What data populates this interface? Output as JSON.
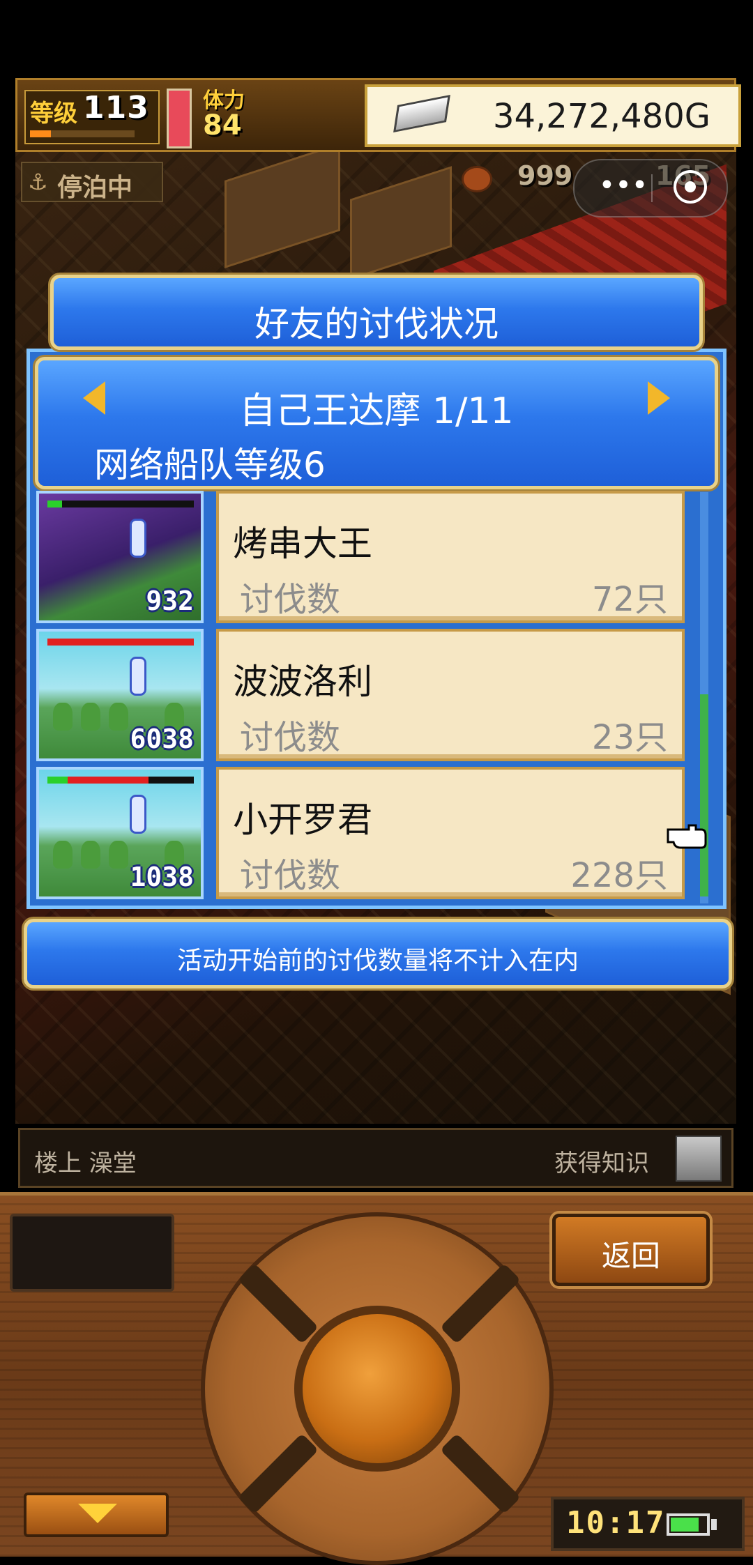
{
  "hud": {
    "level_label": "等级",
    "level": "113",
    "level_progress": 0.2,
    "stamina_label": "体力",
    "stamina": "84",
    "gold": "34,272,480G",
    "moor_label": "停泊中",
    "resource1": "999",
    "resource2": "165"
  },
  "capsule": {
    "more": "•••"
  },
  "dialog": {
    "title": "好友的讨伐状况",
    "monster": "自己王达摩 1/11",
    "fleet_level": "网络船队等级6",
    "notice": "活动开始前的讨伐数量将不计入在内"
  },
  "friends": [
    {
      "name": "烤串大王",
      "kill_label": "讨伐数",
      "kills": "72只",
      "score": "932",
      "hp_fraction": 0.0,
      "green_fraction": 0.1
    },
    {
      "name": "波波洛利",
      "kill_label": "讨伐数",
      "kills": "23只",
      "score": "6038",
      "hp_fraction": 1.0,
      "green_fraction": 0.0
    },
    {
      "name": "小开罗君",
      "kill_label": "讨伐数",
      "kills": "228只",
      "score": "1038",
      "hp_fraction": 0.55,
      "green_fraction": 0.14
    }
  ],
  "status_bar": {
    "location": "楼上 澡堂",
    "knowledge": "获得知识"
  },
  "controller": {
    "back_label": "返回",
    "clock": "10:17"
  },
  "colors": {
    "banner_blue": "#2d78ec",
    "card_bg": "#f6e7c4",
    "gold_frame": "#e9d289",
    "hp_red": "#e22020"
  }
}
